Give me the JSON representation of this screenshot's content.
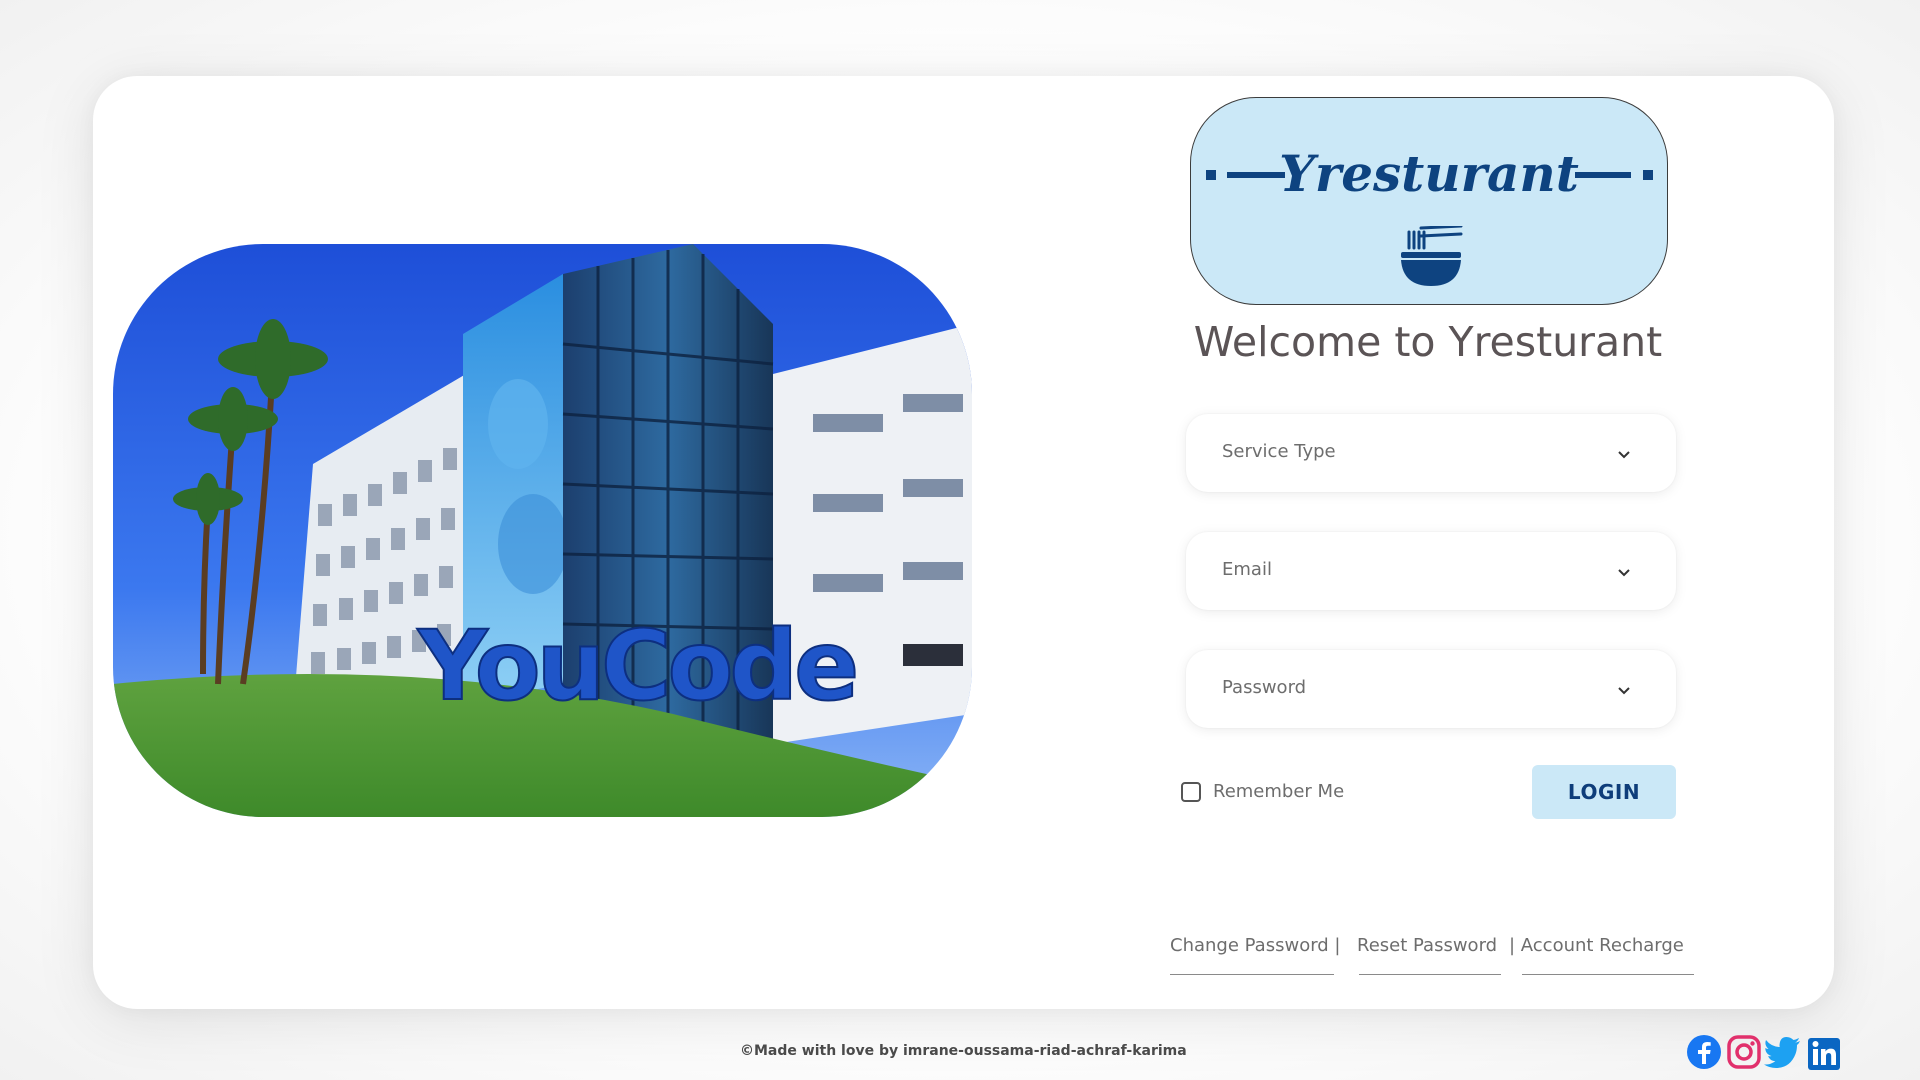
{
  "logo": {
    "title": "Yresturant",
    "icon": "noodle-bowl-icon"
  },
  "welcome_heading": "Welcome to Yresturant",
  "form": {
    "service_type_placeholder": "Service Type",
    "email_placeholder": "Email",
    "password_placeholder": "Password",
    "remember_label": "Remember Me",
    "login_label": "LOGIN"
  },
  "links": {
    "change_password": "Change Password |",
    "reset_password": "Reset Password",
    "account_recharge": "| Account Recharge"
  },
  "photo": {
    "sign_text": "YouCode"
  },
  "footer": {
    "credit": "©Made with love by  imrane-oussama-riad-achraf-karima"
  },
  "social": [
    "facebook-icon",
    "instagram-icon",
    "twitter-icon",
    "linkedin-icon"
  ],
  "colors": {
    "accent_light_blue": "#cbe8f7",
    "brand_navy": "#0e4380",
    "text_gray": "#6d6d6d",
    "heading_gray": "#5b5456",
    "facebook": "#1877f2",
    "instagram": "#e1306c",
    "twitter": "#1da1f2",
    "linkedin": "#0a66c2"
  }
}
